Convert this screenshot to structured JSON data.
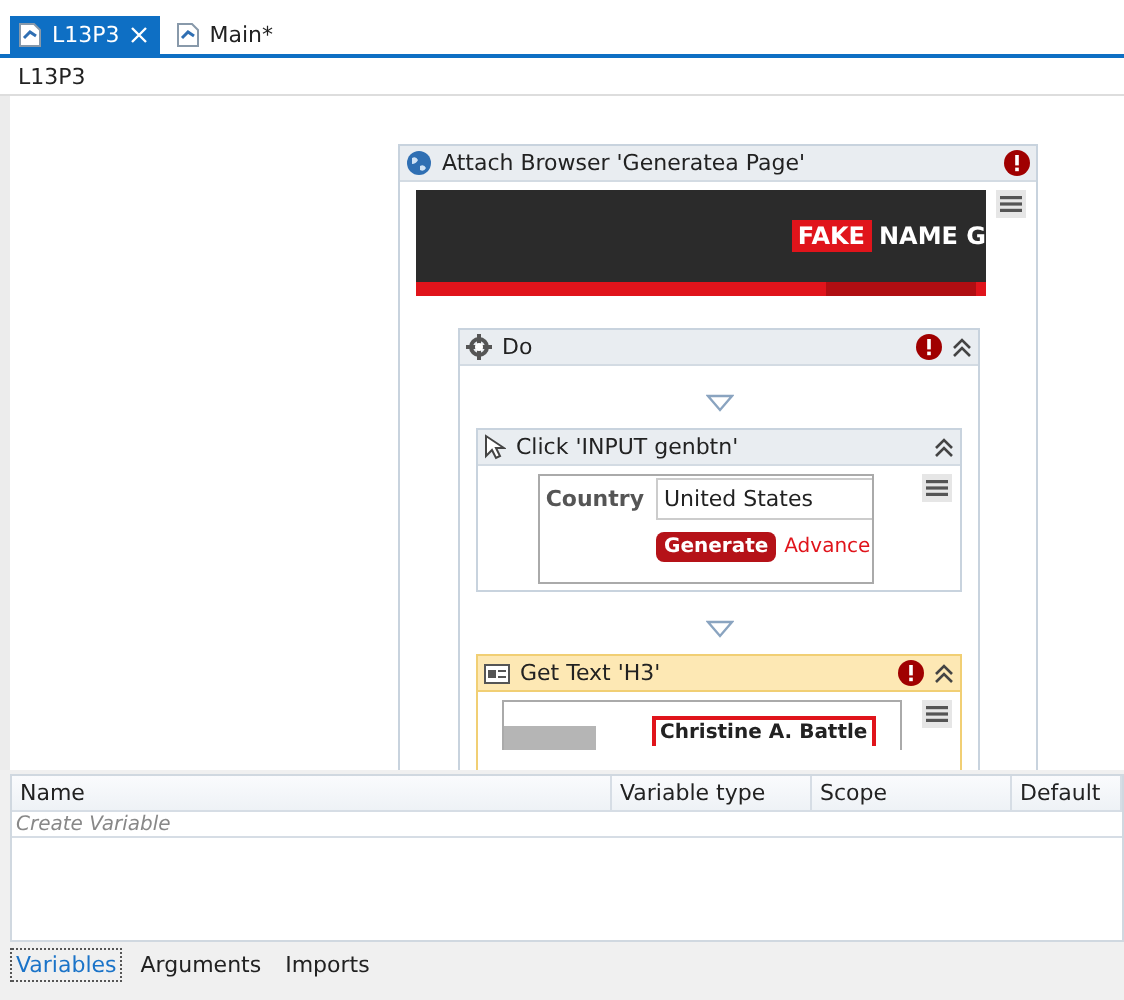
{
  "tabs": [
    {
      "label": "L13P3",
      "selected": true,
      "closable": true
    },
    {
      "label": "Main*",
      "selected": false,
      "closable": false
    }
  ],
  "breadcrumb": "L13P3",
  "attach_browser": {
    "title": "Attach Browser 'Generatea Page'",
    "error": true,
    "screenshot": {
      "badge": "FAKE",
      "heading": "NAME G"
    }
  },
  "sequence": {
    "title": "Do",
    "error": true,
    "expanded": true
  },
  "activities": [
    {
      "kind": "click",
      "title": "Click 'INPUT  genbtn'",
      "error": false,
      "selected": false,
      "expanded": true,
      "screenshot": {
        "label": "Country",
        "value": "United States",
        "button": "Generate",
        "link": "Advance"
      }
    },
    {
      "kind": "get_text",
      "title": "Get Text 'H3'",
      "error": true,
      "selected": true,
      "expanded": true,
      "screenshot": {
        "heading": "Christine A. Battle"
      }
    }
  ],
  "variables_panel": {
    "columns": [
      "Name",
      "Variable type",
      "Scope",
      "Default"
    ],
    "placeholder": "Create Variable"
  },
  "bottom_tabs": [
    {
      "label": "Variables",
      "selected": true
    },
    {
      "label": "Arguments",
      "selected": false
    },
    {
      "label": "Imports",
      "selected": false
    }
  ]
}
